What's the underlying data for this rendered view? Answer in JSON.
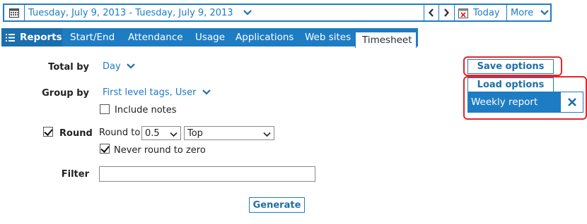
{
  "datebar": {
    "date_range": "Tuesday, July 9, 2013 - Tuesday, July 9, 2013",
    "today_label": "Today",
    "more_label": "More"
  },
  "tabs": {
    "reports": "Reports",
    "items": [
      "Start/End",
      "Attendance",
      "Usage",
      "Applications",
      "Web sites",
      "Timesheet"
    ],
    "active": "Timesheet"
  },
  "form": {
    "total_by_label": "Total by",
    "total_by_value": "Day",
    "group_by_label": "Group by",
    "group_by_value": "First level tags, User",
    "include_notes_label": "Include notes",
    "include_notes_checked": false,
    "round_label": "Round",
    "round_checked": true,
    "round_to_label": "Round to",
    "round_to_value": "0.5",
    "round_direction": "Top",
    "never_round_label": "Never round to zero",
    "never_round_checked": true,
    "filter_label": "Filter",
    "filter_value": "",
    "generate_label": "Generate"
  },
  "options": {
    "save_label": "Save options",
    "load_label": "Load options",
    "saved_items": [
      "Weekly report"
    ]
  },
  "colors": {
    "accent": "#1e7cc3",
    "highlight": "#e0262b"
  }
}
